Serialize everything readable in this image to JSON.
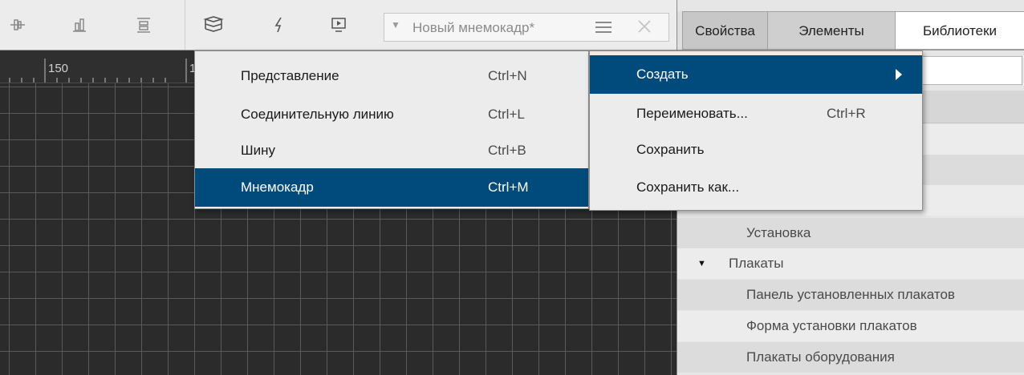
{
  "toolbar": {
    "icons": [
      "align-center-icon",
      "align-bottom-icon",
      "distribute-vertical-icon",
      "layers-icon",
      "lightning-icon",
      "preview-screen-icon"
    ],
    "combo": {
      "value": "Новый мнемокадр*",
      "arrow_icon": "triangle-down-icon",
      "menu_icon": "hamburger-icon",
      "close_icon": "close-icon"
    }
  },
  "canvas": {
    "ruler_labels": [
      "150",
      "1"
    ]
  },
  "panel": {
    "tabs": [
      {
        "label": "Свойства"
      },
      {
        "label": "Элементы"
      },
      {
        "label": "Библиотеки"
      }
    ],
    "tree": [
      {
        "label": "Установка",
        "type": "leaf"
      },
      {
        "label": "Плакаты",
        "type": "group"
      },
      {
        "label": "Панель установленных плакатов",
        "type": "leaf"
      },
      {
        "label": "Форма установки плакатов",
        "type": "leaf"
      },
      {
        "label": "Плакаты оборудования",
        "type": "leaf"
      }
    ]
  },
  "menu_create": {
    "items": [
      {
        "label": "Представление",
        "shortcut": "Ctrl+N"
      },
      {
        "label": "Соединительную линию",
        "shortcut": "Ctrl+L"
      },
      {
        "label": "Шину",
        "shortcut": "Ctrl+B"
      },
      {
        "label": "Мнемокадр",
        "shortcut": "Ctrl+M",
        "selected": true
      }
    ]
  },
  "menu_main": {
    "items": [
      {
        "label": "Создать",
        "shortcut": "",
        "selected": true,
        "submenu": true
      },
      {
        "label": "Переименовать...",
        "shortcut": "Ctrl+R"
      },
      {
        "label": "Сохранить",
        "shortcut": ""
      },
      {
        "label": "Сохранить как...",
        "shortcut": ""
      }
    ]
  },
  "colors": {
    "selection": "#004b7c",
    "canvas_bg": "#2b2b2b",
    "grid_line": "#5a5a5a"
  }
}
